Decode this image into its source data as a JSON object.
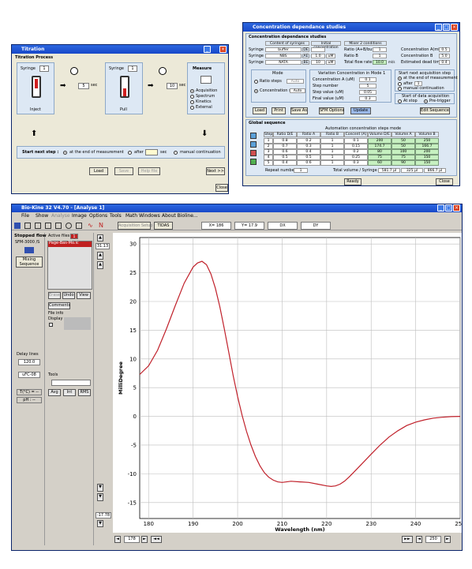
{
  "titration": {
    "window_title": "Titration",
    "header": "Titration Process",
    "syringe1_label": "Syringe",
    "syringe1_value": "1",
    "inject_label": "Inject",
    "wait1_value": "5",
    "wait_unit": "sec",
    "syringe2_label": "Syringe",
    "syringe2_value": "1",
    "pull_label": "Pull",
    "wait2_value": "10",
    "measure_label": "Measure",
    "measure_options": [
      "Acquisition",
      "Spectrum",
      "Kinetics",
      "External"
    ],
    "start_next_step": "Start next step :",
    "opt_end": "at the end of measurement",
    "opt_after": "after",
    "opt_manual": "manual continuation",
    "load": "Load",
    "save": "Save",
    "help": "Help file",
    "next": "Next >>",
    "close": "Close"
  },
  "concentration": {
    "window_title": "Concentration dependance studies",
    "header": "Concentration dependance studies",
    "col_content": "Content of syringes",
    "col_initial": "Initial concentration",
    "col_mixer": "Mixer 2 conditions",
    "syringes": [
      {
        "label": "Syringe (1)",
        "content": "buffer",
        "flag": "DE",
        "conc": "",
        "unit": ""
      },
      {
        "label": "Syringe (2)",
        "content": "NBS",
        "flag": "AE",
        "conc": "1.0",
        "unit": "uM"
      },
      {
        "label": "Syringe (3)",
        "content": "NATA",
        "flag": "BE",
        "conc": "10",
        "unit": "uM"
      }
    ],
    "ratio_a": "Ratio (A+B/buffer)",
    "ratio_a_val": "1",
    "ratio_b": "Ratio B",
    "ratio_b_val": "1",
    "total_flow": "Total flow rate",
    "total_flow_val": "10.0",
    "total_flow_unit": "ml/s",
    "conc_a": "Concentration A(mix)",
    "conc_a_val": "0.5",
    "conc_b": "Concentration B",
    "conc_b_val": "5.0",
    "dead_time": "Estimated dead time",
    "dead_time_val": "0.4",
    "mode_label": "Mode",
    "mode_ratio": "Ratio steps",
    "mode_conc": "Concentration steps",
    "mode_auto": "Auto",
    "variation_label": "Variation Concentration in Mode 1",
    "var_conc": "Concentration A (uM)",
    "var_conc_val": "0.1",
    "var_step_n": "Step number",
    "var_step_n_val": "5",
    "var_step_v": "Step value (uM)",
    "var_step_v_val": "0.05",
    "var_final": "Final value (uM)",
    "var_final_val": "0.3",
    "next_acq_label": "Start next acquisition step",
    "acq_end": "at the end of measurement",
    "acq_after": "after",
    "acq_after_val": "1",
    "acq_manual": "manual continuation",
    "data_acq_label": "Start of data acquisition",
    "data_acq_stop": "At stop",
    "data_acq_pre": "Pre-trigger",
    "btn_load": "Load",
    "btn_print": "Print",
    "btn_save": "Save As",
    "btn_sfm": "SFM Options",
    "btn_update": "Update",
    "btn_edit": "Edit Sequence",
    "global_label": "Global sequence",
    "auto_table_label": "Automation concentration steps mode",
    "table_headers": [
      "Step",
      "Ratio D/E",
      "Ratio A",
      "Ratio B",
      "Concent (A)",
      "Volume D/E",
      "Volume A",
      "Volume B"
    ],
    "table_rows": [
      [
        "1",
        "0.8",
        "0.2",
        "1",
        "0.1",
        "200",
        "50",
        "250"
      ],
      [
        "2",
        "0.7",
        "0.3",
        "1",
        "0.15",
        "174.7",
        "50",
        "166.7"
      ],
      [
        "3",
        "0.6",
        "0.4",
        "1",
        "0.2",
        "80",
        "100",
        "200"
      ],
      [
        "4",
        "0.5",
        "0.5",
        "1",
        "0.25",
        "75",
        "75",
        "150"
      ],
      [
        "5",
        "0.4",
        "0.6",
        "1",
        "0.3",
        "60",
        "90",
        "150"
      ]
    ],
    "repeat_label": "Repeat number",
    "repeat_val": "1",
    "total_vol_label": "Total volume / Syringe",
    "total_vol_de": "581.7 µl",
    "total_vol_a": "325 µl",
    "total_vol_b": "866.7 µl",
    "ready": "Ready",
    "close": "Close"
  },
  "biokine": {
    "window_title": "Bio-Kine 32  V4.70 - [Analyse 1]",
    "menu": [
      "File",
      "Show",
      "Analyse",
      "Image",
      "Options",
      "Tools",
      "Math",
      "Windows",
      "About Bioline..."
    ],
    "acq_setup": "Acquisition Setup",
    "tidas": "TIDAS",
    "x_readout": "X= 186",
    "y_readout": "Y= 17.9",
    "dx_readout": "DX",
    "dy_readout": "DY",
    "instrument": "Stopped flow",
    "instrument_model": "SFM-3000 /S",
    "mixing_seq": "Mixing Sequence",
    "active_files": "Active files",
    "active_count": "1",
    "file_name": "Page-Bas-Mo.ic",
    "erase": "Erase",
    "undo": "Undo",
    "view": "View",
    "comments": "Comments",
    "file_info": "File info",
    "display": "Display",
    "delay_lines": "Delay lines",
    "delay_val": "120.0",
    "ufc": "uFC-08",
    "tools": "Tools",
    "avg": "Avg",
    "int": "Int",
    "rms": "RMS",
    "temp": "T(°C) = --",
    "ph": "pH : --",
    "y_top_box": "31.13",
    "y_bottom_box": "-17.78",
    "x_left_box": "178",
    "x_right_box": "250"
  },
  "chart_data": {
    "type": "line",
    "xlabel": "Wavelength (nm)",
    "ylabel": "MilliDegree",
    "xlim": [
      178,
      250
    ],
    "ylim": [
      -17.78,
      31.13
    ],
    "xticks": [
      180,
      190,
      200,
      210,
      220,
      230,
      240,
      250
    ],
    "yticks": [
      30,
      25,
      20,
      15,
      10,
      5,
      0,
      -5,
      -10,
      -15
    ],
    "grid": true,
    "color": "#c0202a",
    "x": [
      178,
      180,
      182,
      184,
      186,
      188,
      190,
      191,
      192,
      193,
      194,
      195,
      196,
      197,
      198,
      199,
      200,
      201,
      202,
      203,
      204,
      205,
      206,
      207,
      208,
      209,
      210,
      212,
      214,
      216,
      218,
      220,
      221,
      222,
      223,
      224,
      225,
      226,
      228,
      230,
      232,
      234,
      236,
      238,
      240,
      242,
      244,
      246,
      248,
      250
    ],
    "y": [
      7.3,
      8.8,
      11.5,
      15.2,
      19.3,
      23.2,
      26.0,
      26.7,
      27.0,
      26.4,
      24.8,
      22.3,
      19.1,
      15.3,
      11.2,
      7.1,
      3.4,
      0.2,
      -2.6,
      -5.0,
      -7.0,
      -8.6,
      -9.8,
      -10.6,
      -11.1,
      -11.4,
      -11.5,
      -11.3,
      -11.4,
      -11.5,
      -11.8,
      -12.1,
      -12.2,
      -12.1,
      -11.8,
      -11.3,
      -10.6,
      -9.8,
      -8.2,
      -6.6,
      -5.0,
      -3.6,
      -2.5,
      -1.6,
      -1.0,
      -0.6,
      -0.3,
      -0.15,
      -0.05,
      0.0
    ]
  }
}
